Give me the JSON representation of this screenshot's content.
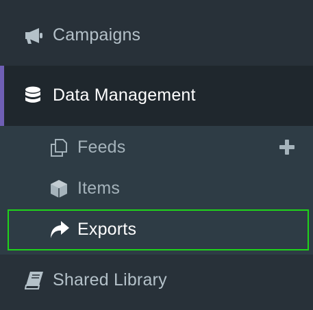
{
  "nav": {
    "campaigns": {
      "label": "Campaigns",
      "icon": "megaphone-icon"
    },
    "data_management": {
      "label": "Data Management",
      "icon": "database-icon",
      "active": true,
      "accent_color": "#6f5fb5",
      "children": [
        {
          "label": "Feeds",
          "icon": "copy-icon",
          "action_icon": "plus-icon"
        },
        {
          "label": "Items",
          "icon": "cube-icon"
        },
        {
          "label": "Exports",
          "icon": "share-arrow-icon",
          "selected": true,
          "highlight_color": "#1fd41a"
        }
      ]
    },
    "shared_library": {
      "label": "Shared Library",
      "icon": "book-icon"
    }
  }
}
